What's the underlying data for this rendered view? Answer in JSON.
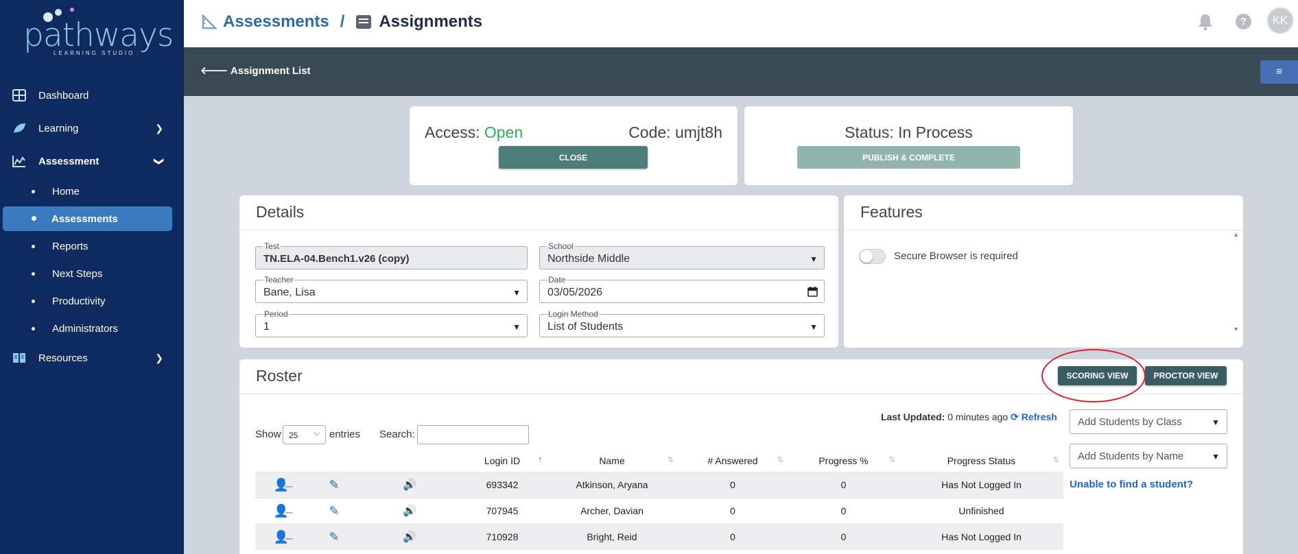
{
  "sidebar": {
    "logo": {
      "word": "pathways",
      "sub": "LEARNING STUDIO"
    },
    "items": [
      {
        "label": "Dashboard",
        "icon": "dashboard-icon"
      },
      {
        "label": "Learning",
        "icon": "leaf-icon"
      },
      {
        "label": "Assessment",
        "icon": "chart-icon"
      },
      {
        "label": "Resources",
        "icon": "book-icon"
      }
    ],
    "subitems": [
      "Home",
      "Assessments",
      "Reports",
      "Next Steps",
      "Productivity",
      "Administrators"
    ]
  },
  "header": {
    "crumb1": "Assessments",
    "separator": "/",
    "crumb2": "Assignments",
    "avatar": "KK",
    "help": "?"
  },
  "subheader": {
    "back_label": "Assignment List",
    "menu": "≡"
  },
  "access_card": {
    "access_label": "Access:",
    "access_value": "Open",
    "code_label": "Code:",
    "code_value": "umjt8h",
    "close_label": "CLOSE"
  },
  "status_card": {
    "status_text": "Status: In Process",
    "publish_label": "PUBLISH & COMPLETE"
  },
  "details": {
    "title": "Details",
    "test": {
      "label": "Test",
      "value": "TN.ELA-04.Bench1.v26 (copy)"
    },
    "school": {
      "label": "School",
      "value": "Northside Middle"
    },
    "teacher": {
      "label": "Teacher",
      "value": "Bane, Lisa"
    },
    "date": {
      "label": "Date",
      "value": "03/05/2026"
    },
    "period": {
      "label": "Period",
      "value": "1"
    },
    "login_method": {
      "label": "Login Method",
      "value": "List of Students"
    }
  },
  "features": {
    "title": "Features",
    "secure_browser_label": "Secure Browser is required",
    "secure_browser_on": false
  },
  "roster": {
    "title": "Roster",
    "scoring_view_label": "SCORING VIEW",
    "proctor_view_label": "PROCTOR VIEW",
    "show_label": "Show",
    "entries_value": "25",
    "entries_label": "entries",
    "search_label": "Search:",
    "search_value": "",
    "last_updated_label": "Last Updated:",
    "last_updated_value": "0 minutes ago",
    "refresh_label": "Refresh",
    "add_by_class_placeholder": "Add Students by Class",
    "add_by_name_placeholder": "Add Students by Name",
    "unable_link": "Unable to find a student?",
    "columns": [
      "Login ID",
      "Name",
      "# Answered",
      "Progress %",
      "Progress Status"
    ],
    "rows": [
      {
        "login_id": "693342",
        "name": "Atkinson, Aryana",
        "answered": "0",
        "progress": "0",
        "status": "Has Not Logged In"
      },
      {
        "login_id": "707945",
        "name": "Archer, Davian",
        "answered": "0",
        "progress": "0",
        "status": "Unfinished"
      },
      {
        "login_id": "710928",
        "name": "Bright, Reid",
        "answered": "0",
        "progress": "0",
        "status": "Has Not Logged In"
      }
    ]
  },
  "colors": {
    "sidebar": "#0f2a5e",
    "active": "#3a7bc0",
    "open": "#2fae5a",
    "teal": "#4b7d79",
    "annotation": "#d8232a"
  }
}
